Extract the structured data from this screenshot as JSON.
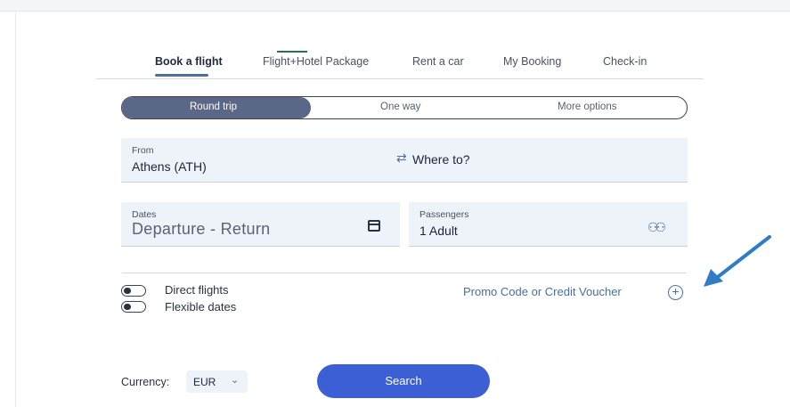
{
  "tabs": [
    {
      "label": "Book a flight",
      "active": true
    },
    {
      "label": "Flight+Hotel Package",
      "active": false
    },
    {
      "label": "Rent a car",
      "active": false
    },
    {
      "label": "My Booking",
      "active": false
    },
    {
      "label": "Check-in",
      "active": false
    }
  ],
  "trip_type": {
    "options": [
      "Round trip",
      "One way",
      "More options"
    ],
    "selected": "Round trip"
  },
  "from_field": {
    "label": "From",
    "value": "Athens (ATH)"
  },
  "to_field": {
    "placeholder": "Where to?"
  },
  "dates_field": {
    "label": "Dates",
    "placeholder": "Departure - Return"
  },
  "passengers_field": {
    "label": "Passengers",
    "value": "1 Adult"
  },
  "toggles": [
    {
      "label": "Direct flights",
      "on": false
    },
    {
      "label": "Flexible dates",
      "on": false
    }
  ],
  "promo": {
    "label": "Promo Code or Credit Voucher"
  },
  "currency": {
    "label": "Currency:",
    "value": "EUR"
  },
  "search_button": {
    "label": "Search"
  },
  "colors": {
    "accent": "#3d5fd6",
    "active_segment": "#5a6787",
    "arrow": "#2f7cc7"
  }
}
